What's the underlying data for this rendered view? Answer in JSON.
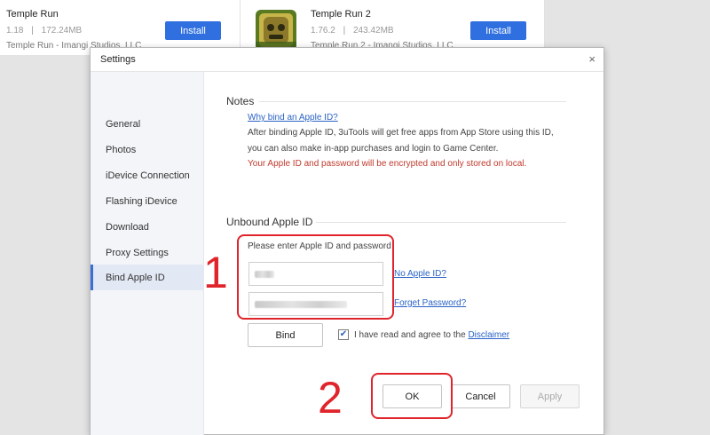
{
  "background": {
    "apps": [
      {
        "name": "Temple Run",
        "version": "1.18",
        "size": "172.24MB",
        "developer": "Temple Run - Imangi Studios, LLC",
        "install_label": "Install"
      },
      {
        "name": "Temple Run 2",
        "version": "1.76.2",
        "size": "243.42MB",
        "developer": "Temple Run 2 - Imangi Studios, LLC",
        "install_label": "Install"
      }
    ],
    "meta_separator": "|"
  },
  "dialog": {
    "title": "Settings",
    "close_glyph": "×"
  },
  "sidebar": {
    "items": [
      {
        "label": "General"
      },
      {
        "label": "Photos"
      },
      {
        "label": "iDevice Connection"
      },
      {
        "label": "Flashing iDevice"
      },
      {
        "label": "Download"
      },
      {
        "label": "Proxy Settings"
      },
      {
        "label": "Bind Apple ID"
      }
    ],
    "active_index": 6
  },
  "notes": {
    "title": "Notes",
    "link": "Why bind an Apple ID?",
    "line1": "After binding Apple ID, 3uTools will get free apps from App Store using this ID,",
    "line2": "you can also make in-app purchases and login to Game Center.",
    "warning": "Your Apple ID and password will be encrypted and only stored on local."
  },
  "unbound": {
    "title": "Unbound Apple ID",
    "prompt": "Please enter Apple ID and password",
    "no_apple_id_link": "No Apple ID?",
    "forget_password_link": "Forget Password?",
    "bind_label": "Bind",
    "agree_text": "I have read and agree to the",
    "disclaimer_link": "Disclaimer",
    "agree_checked": true,
    "check_glyph": "✔"
  },
  "footer": {
    "ok_label": "OK",
    "cancel_label": "Cancel",
    "apply_label": "Apply"
  },
  "annotations": {
    "marker1": "1",
    "marker2": "2",
    "color": "#e0242b"
  },
  "colors": {
    "accent": "#2f6fe0",
    "sidebar_active": "#3a6fd8",
    "warning": "#c0392b",
    "link": "#2a63c5"
  }
}
